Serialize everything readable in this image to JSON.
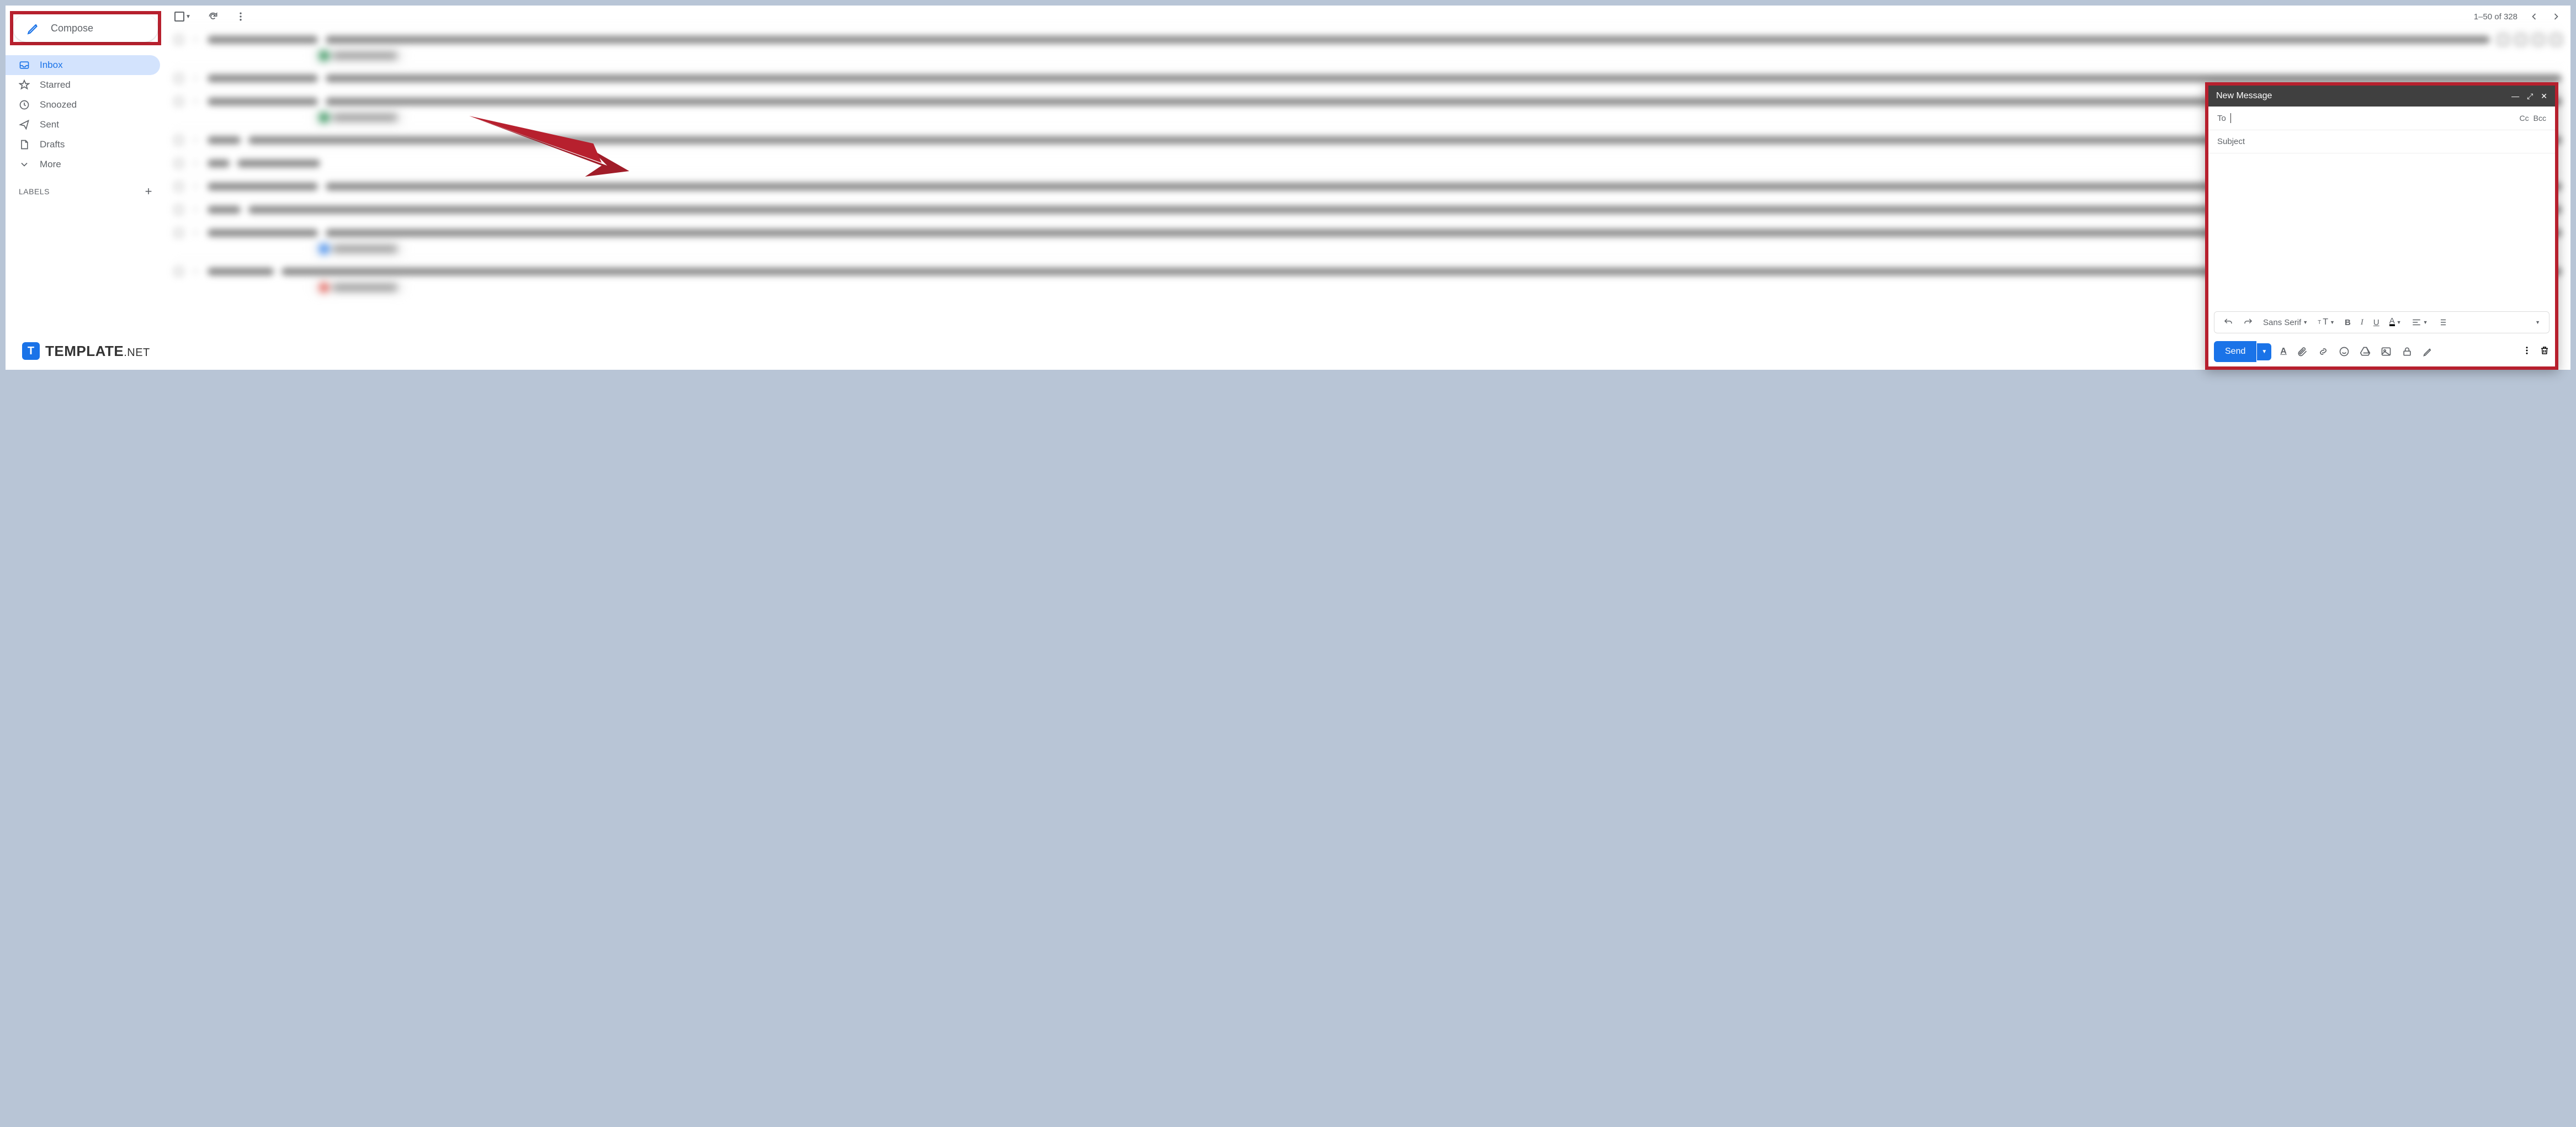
{
  "compose": {
    "label": "Compose"
  },
  "nav": {
    "inbox": "Inbox",
    "starred": "Starred",
    "snoozed": "Snoozed",
    "sent": "Sent",
    "drafts": "Drafts",
    "more": "More"
  },
  "labels_header": "LABELS",
  "pagination": "1–50 of 328",
  "compose_window": {
    "title": "New Message",
    "to_label": "To",
    "cc": "Cc",
    "bcc": "Bcc",
    "subject_placeholder": "Subject",
    "font": "Sans Serif",
    "send": "Send"
  },
  "watermark": {
    "icon": "T",
    "brand": "TEMPLATE",
    "tld": ".NET"
  }
}
